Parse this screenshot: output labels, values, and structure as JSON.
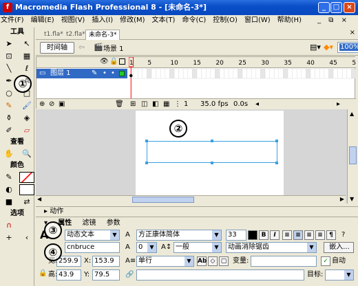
{
  "window": {
    "title": "Macromedia Flash Professional 8 - [未命名-3*]",
    "min": "_",
    "max": "□",
    "close": "×"
  },
  "menu": [
    "文件(F)",
    "编辑(E)",
    "视图(V)",
    "插入(I)",
    "修改(M)",
    "文本(T)",
    "命令(C)",
    "控制(O)",
    "窗口(W)",
    "帮助(H)"
  ],
  "menu_right": "_ ⧉ ×",
  "tools": {
    "header": "工具",
    "view_header": "查看",
    "color_header": "颜色",
    "options_header": "选项"
  },
  "doc_tabs": [
    "t1.fla*",
    "t2.fla*",
    "未命名-3*"
  ],
  "editbar": {
    "timeline_btn": "时间轴",
    "scene": "场景 1",
    "zoom": "100%"
  },
  "timeline": {
    "frame_numbers": [
      "1",
      "5",
      "10",
      "15",
      "20",
      "25",
      "30",
      "35",
      "40",
      "45",
      "50"
    ],
    "layer": "图层 1",
    "current_frame": "1",
    "fps": "35.0 fps",
    "time": "0.0s"
  },
  "callouts": [
    "①",
    "②",
    "③",
    "④"
  ],
  "panels": {
    "actions": "动作",
    "tabs": [
      "属性",
      "滤镜",
      "参数"
    ]
  },
  "props": {
    "text_type": "动态文本",
    "font": "方正康体简体",
    "size": "33",
    "bold": "B",
    "italic": "I",
    "instance_name": "cnbruce",
    "letter_spacing": "0",
    "baseline": "一般",
    "anti_alias": "动画消除锯齿",
    "embed": "嵌入...",
    "w_label": "宽:",
    "w": "259.9",
    "x_label": "X:",
    "x": "153.9",
    "h_label": "高:",
    "h": "43.9",
    "y_label": "Y:",
    "y": "79.5",
    "line_type": "单行",
    "var_label": "变量:",
    "auto_label": "自动",
    "target_label": "目标:"
  },
  "colors": {
    "title": "#0a4fc8",
    "selection": "#316ac5"
  }
}
